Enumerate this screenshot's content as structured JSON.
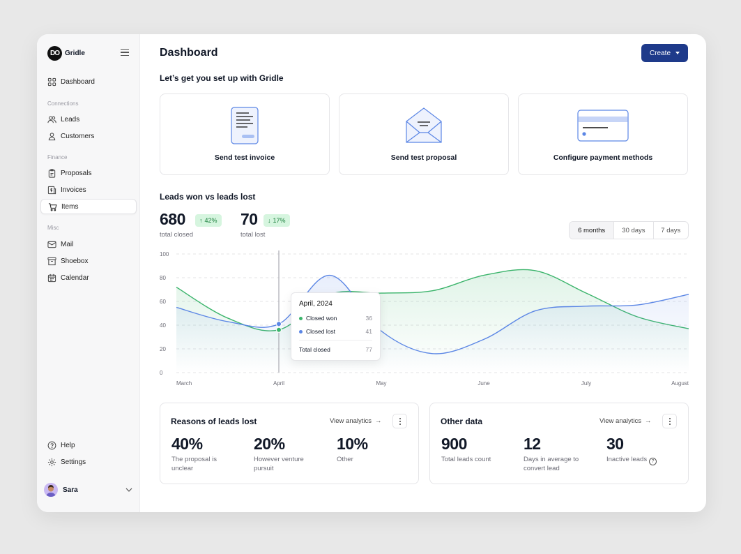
{
  "app": {
    "name": "Gridle",
    "logo_text": "DO"
  },
  "sidebar": {
    "top_item": {
      "label": "Dashboard"
    },
    "sections": [
      {
        "label": "Connections",
        "items": [
          {
            "label": "Leads"
          },
          {
            "label": "Customers"
          }
        ]
      },
      {
        "label": "Finance",
        "items": [
          {
            "label": "Proposals"
          },
          {
            "label": "Invoices"
          },
          {
            "label": "Items",
            "active": true
          }
        ]
      },
      {
        "label": "Misc",
        "items": [
          {
            "label": "Mail"
          },
          {
            "label": "Shoebox"
          },
          {
            "label": "Calendar"
          }
        ]
      }
    ],
    "bottom_items": [
      {
        "label": "Help"
      },
      {
        "label": "Settings"
      }
    ],
    "user": {
      "name": "Sara"
    }
  },
  "header": {
    "title": "Dashboard",
    "create_label": "Create"
  },
  "setup": {
    "title": "Let’s get you set up with Gridle",
    "cards": [
      {
        "label": "Send test invoice"
      },
      {
        "label": "Send test proposal"
      },
      {
        "label": "Configure payment methods"
      }
    ]
  },
  "leads": {
    "title": "Leads won vs leads lost",
    "closed": {
      "value": "680",
      "change": "42%",
      "label": "total closed"
    },
    "lost": {
      "value": "70",
      "change": "17%",
      "label": "total lost"
    },
    "ranges": [
      "6 months",
      "30 days",
      "7 days"
    ],
    "selected_range": "6 months"
  },
  "chart_data": {
    "type": "line",
    "categories": [
      "March",
      "April",
      "May",
      "June",
      "July",
      "August"
    ],
    "x": [
      0,
      0.5,
      1,
      1.5,
      2,
      2.5,
      3,
      3.5,
      4,
      4.5,
      5
    ],
    "ylim": [
      0,
      100
    ],
    "yticks": [
      0,
      20,
      40,
      60,
      80,
      100
    ],
    "grid": true,
    "series": [
      {
        "name": "Closed won",
        "color": "#3bb46b",
        "values": [
          72,
          46,
          36,
          66,
          67,
          69,
          82,
          86,
          67,
          47,
          37
        ]
      },
      {
        "name": "Closed lost",
        "color": "#5b86e5",
        "values": [
          55,
          43,
          41,
          82,
          35,
          16,
          28,
          52,
          56,
          57,
          66
        ]
      }
    ],
    "tooltip": {
      "title": "April, 2024",
      "rows": [
        {
          "label": "Closed won",
          "value": "36"
        },
        {
          "label": "Closed lost",
          "value": "41"
        }
      ],
      "total_label": "Total closed",
      "total_value": "77"
    }
  },
  "reasons": {
    "title": "Reasons of leads lost",
    "link": "View analytics",
    "stats": [
      {
        "value": "40%",
        "desc": "The proposal is unclear"
      },
      {
        "value": "20%",
        "desc": "However venture pursuit"
      },
      {
        "value": "10%",
        "desc": "Other"
      }
    ]
  },
  "other": {
    "title": "Other data",
    "link": "View analytics",
    "stats": [
      {
        "value": "900",
        "desc": "Total leads count"
      },
      {
        "value": "12",
        "desc": "Days in average to convert lead"
      },
      {
        "value": "30",
        "desc": "Inactive leads"
      }
    ]
  },
  "colors": {
    "accent": "#1e3a8a",
    "won": "#3bb46b",
    "lost": "#5b86e5",
    "badge_bg": "#d6f5df"
  },
  "icons": {
    "arrow_up": "↑",
    "arrow_down": "↓",
    "arrow_right": "→",
    "help_question": "?"
  }
}
